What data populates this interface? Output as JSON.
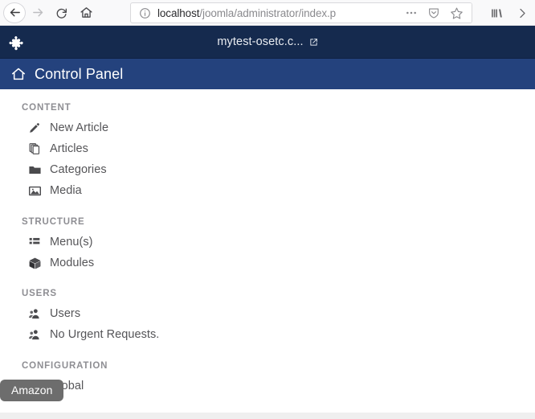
{
  "browser": {
    "nav": {
      "back_label": "Back",
      "forward_label": "Forward",
      "reload_label": "Reload",
      "home_label": "Home"
    },
    "url": {
      "host": "localhost",
      "path": "/joomla/administrator/index.p",
      "full": "localhost/joomla/administrator/index.p",
      "security_icon": "info-icon"
    },
    "urlbar_actions": [
      {
        "name": "page-actions-icon",
        "glyph": "…"
      },
      {
        "name": "pocket-icon",
        "glyph": "shield"
      },
      {
        "name": "bookmark-star-icon",
        "glyph": "☆"
      }
    ],
    "toolbar_right": [
      {
        "name": "library-icon",
        "glyph": "library"
      },
      {
        "name": "overflow-chevron-icon",
        "glyph": "»"
      }
    ]
  },
  "joomla": {
    "logo_name": "joomla-logo",
    "site_name": "mytest-osetc.c...",
    "site_link_icon": "external-link-icon",
    "control_panel": {
      "home_icon": "home-icon",
      "title": "Control Panel"
    }
  },
  "sidebar": {
    "sections": [
      {
        "title": "CONTENT",
        "items": [
          {
            "label": "New Article",
            "icon": "pencil-icon"
          },
          {
            "label": "Articles",
            "icon": "copy-stack-icon"
          },
          {
            "label": "Categories",
            "icon": "folder-icon"
          },
          {
            "label": "Media",
            "icon": "image-icon"
          }
        ]
      },
      {
        "title": "STRUCTURE",
        "items": [
          {
            "label": "Menu(s)",
            "icon": "list-icon"
          },
          {
            "label": "Modules",
            "icon": "cube-icon"
          }
        ]
      },
      {
        "title": "USERS",
        "items": [
          {
            "label": "Users",
            "icon": "users-icon"
          },
          {
            "label": "No Urgent Requests.",
            "icon": "users-icon"
          }
        ]
      },
      {
        "title": "CONFIGURATION",
        "items": [
          {
            "label": "Global",
            "icon": "gear-icon"
          }
        ]
      }
    ]
  },
  "tooltip": {
    "text": "Amazon"
  },
  "colors": {
    "topbar": "#152a4e",
    "control_panel_bar": "#24427d",
    "section_title": "#8e8e93",
    "nav_label": "#555558",
    "tooltip_bg": "#6d6d6d",
    "chrome_bg": "#f9f9fa"
  }
}
